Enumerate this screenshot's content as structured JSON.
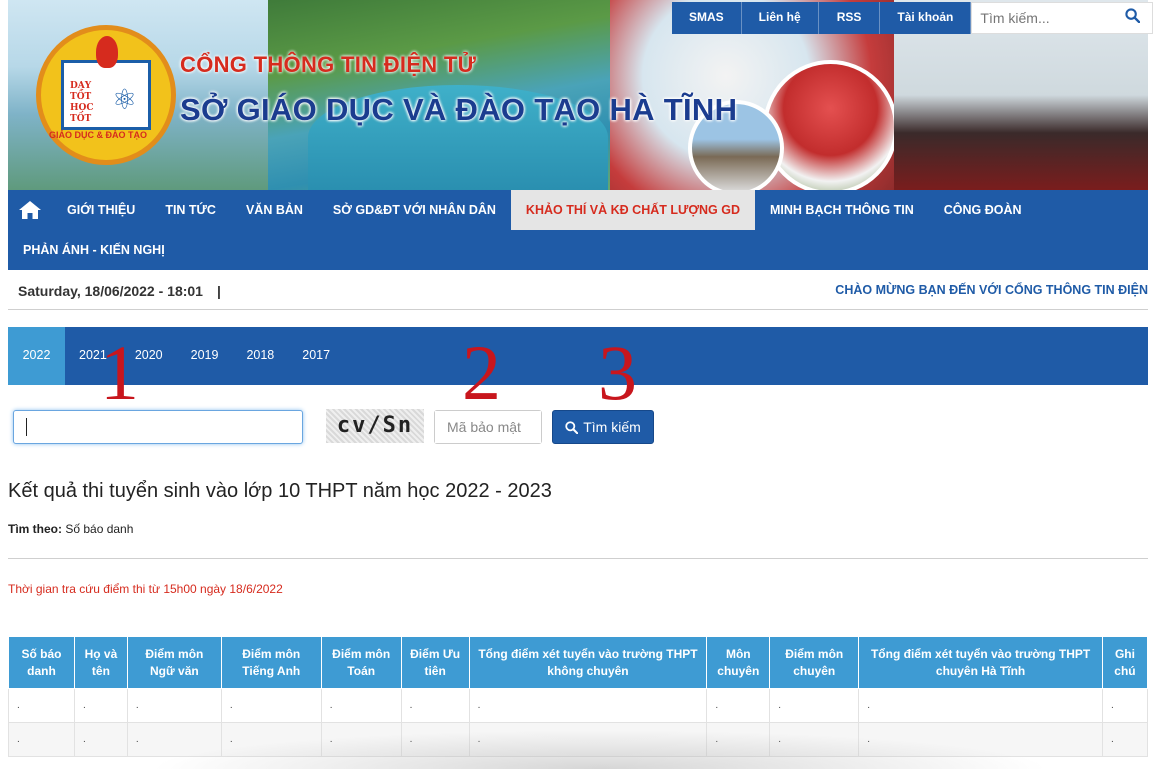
{
  "header": {
    "title_small": "CỔNG THÔNG TIN ĐIỆN TỬ",
    "title_big": "SỞ GIÁO DỤC VÀ ĐÀO TẠO HÀ TĨNH",
    "logo_text_top": "DẠY TỐT HỌC TỐT",
    "logo_text_ring": "GIÁO DỤC & ĐÀO TẠO"
  },
  "utility": {
    "links": [
      "SMAS",
      "Liên hệ",
      "RSS",
      "Tài khoản"
    ],
    "search_placeholder": "Tìm kiếm..."
  },
  "nav": {
    "row1": [
      "GIỚI THIỆU",
      "TIN TỨC",
      "VĂN BẢN",
      "SỞ GD&ĐT VỚI NHÂN DÂN",
      "KHẢO THÍ VÀ KĐ CHẤT LƯỢNG GD",
      "MINH BẠCH THÔNG TIN",
      "CÔNG ĐOÀN"
    ],
    "row2": [
      "PHẢN ÁNH - KIẾN NGHỊ"
    ],
    "active": "KHẢO THÍ VÀ KĐ CHẤT LƯỢNG GD"
  },
  "datebar": {
    "date": "Saturday, 18/06/2022 - 18:01",
    "separator": "|",
    "welcome": "CHÀO MỪNG BẠN ĐẾN VỚI CỔNG THÔNG TIN ĐIỆN"
  },
  "years": {
    "tabs": [
      "2022",
      "2021",
      "2020",
      "2019",
      "2018",
      "2017"
    ],
    "active": "2022"
  },
  "annotations": [
    "1",
    "2",
    "3"
  ],
  "search_form": {
    "sbd_value": "",
    "captcha_text": "cv/Sn",
    "code_placeholder": "Mã bảo mật",
    "submit_label": "Tìm kiếm"
  },
  "result": {
    "title": "Kết quả thi tuyển sinh vào lớp 10 THPT năm học 2022 - 2023",
    "by_label": "Tìm theo:",
    "by_value": "Số báo danh",
    "notice": "Thời gian tra cứu điểm thi từ 15h00 ngày 18/6/2022"
  },
  "table": {
    "columns": [
      "Số báo danh",
      "Họ và tên",
      "Điểm môn Ngữ văn",
      "Điểm môn Tiếng Anh",
      "Điểm môn Toán",
      "Điểm Ưu tiên",
      "Tổng điểm xét tuyển vào trường THPT không chuyên",
      "Môn chuyên",
      "Điểm môn chuyên",
      "Tổng điểm xét tuyển vào trường THPT chuyên Hà Tĩnh",
      "Ghi chú"
    ],
    "rows": [
      [
        ".",
        ".",
        ".",
        ".",
        ".",
        ".",
        ".",
        ".",
        ".",
        ".",
        "."
      ],
      [
        ".",
        ".",
        ".",
        ".",
        ".",
        ".",
        ".",
        ".",
        ".",
        ".",
        "."
      ]
    ]
  },
  "colors": {
    "primary": "#1f5ba7",
    "accent": "#3e9bd3",
    "red": "#d62b1e",
    "annotation": "#c8161d"
  }
}
